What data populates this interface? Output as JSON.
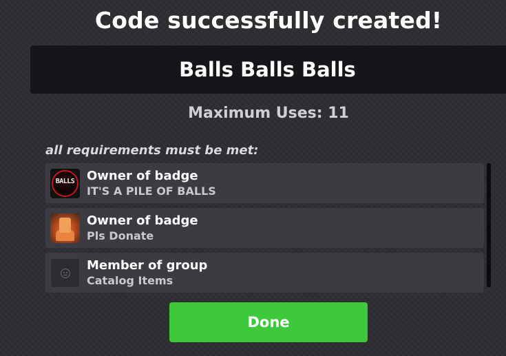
{
  "dialog": {
    "title": "Code successfully created!",
    "code": "Balls Balls Balls",
    "max_uses_label": "Maximum Uses: 11",
    "requirements_label": "all requirements must be met:"
  },
  "requirements": [
    {
      "title": "Owner of badge",
      "subtitle": "IT'S A PILE OF BALLS",
      "thumb_text": "BALLS",
      "icon": "balls-badge-icon"
    },
    {
      "title": "Owner of badge",
      "subtitle": "Pls Donate",
      "icon": "donate-badge-icon"
    },
    {
      "title": "Member of group",
      "subtitle": "Catalog Items",
      "icon": "group-placeholder-icon"
    }
  ],
  "done_button": {
    "label": "Done"
  },
  "colors": {
    "background": "#2e2e33",
    "code_box": "#16161a",
    "item_bg": "#3b3b41",
    "done_green": "#3ec93d"
  }
}
